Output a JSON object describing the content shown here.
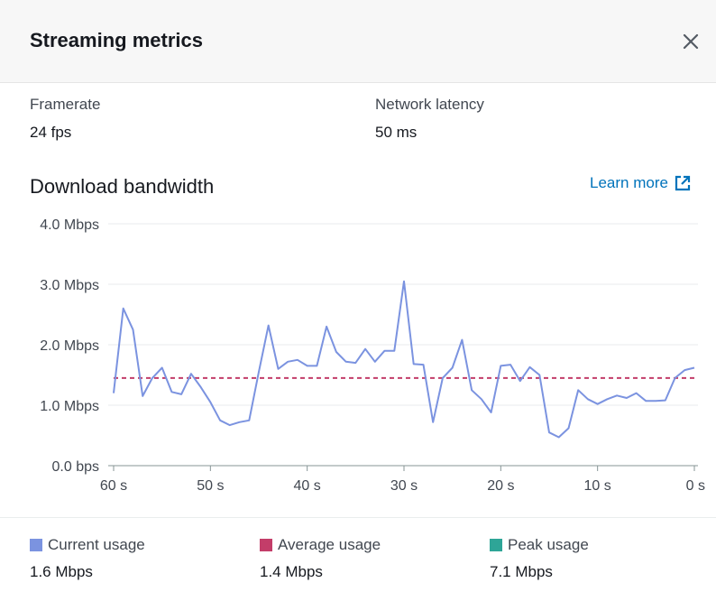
{
  "header": {
    "title": "Streaming metrics"
  },
  "metrics": [
    {
      "label": "Framerate",
      "value": "24 fps"
    },
    {
      "label": "Network latency",
      "value": "50 ms"
    }
  ],
  "bandwidth": {
    "title": "Download bandwidth",
    "learn_more": "Learn more"
  },
  "chart_data": {
    "type": "line",
    "title": "Download bandwidth",
    "x_tick_labels": [
      "60 s",
      "50 s",
      "40 s",
      "30 s",
      "20 s",
      "10 s",
      "0 s"
    ],
    "y_tick_labels": [
      "0.0 bps",
      "1.0 Mbps",
      "2.0 Mbps",
      "3.0 Mbps",
      "4.0 Mbps"
    ],
    "xlim": [
      60,
      0
    ],
    "ylim": [
      0,
      4
    ],
    "grid": true,
    "series": [
      {
        "name": "Current usage",
        "color": "#7b93e0",
        "x": [
          60,
          59,
          58,
          57,
          56,
          55,
          54,
          53,
          52,
          51,
          50,
          49,
          48,
          47,
          46,
          45,
          44,
          43,
          42,
          41,
          40,
          39,
          38,
          37,
          36,
          35,
          34,
          33,
          32,
          31,
          30,
          29,
          28,
          27,
          26,
          25,
          24,
          23,
          22,
          21,
          20,
          19,
          18,
          17,
          16,
          15,
          14,
          13,
          12,
          11,
          10,
          9,
          8,
          7,
          6,
          5,
          4,
          3,
          2,
          1,
          0
        ],
        "values": [
          1.2,
          2.6,
          2.25,
          1.15,
          1.45,
          1.62,
          1.22,
          1.18,
          1.52,
          1.3,
          1.05,
          0.75,
          0.67,
          0.72,
          0.75,
          1.55,
          2.32,
          1.6,
          1.72,
          1.75,
          1.65,
          1.65,
          2.3,
          1.88,
          1.72,
          1.7,
          1.93,
          1.72,
          1.9,
          1.9,
          3.05,
          1.68,
          1.67,
          0.72,
          1.45,
          1.62,
          2.08,
          1.25,
          1.1,
          0.88,
          1.65,
          1.67,
          1.4,
          1.63,
          1.5,
          0.55,
          0.47,
          0.62,
          1.25,
          1.1,
          1.02,
          1.1,
          1.16,
          1.12,
          1.2,
          1.07,
          1.07,
          1.08,
          1.45,
          1.58,
          1.62
        ]
      },
      {
        "name": "Average usage",
        "color": "#c33d69",
        "x": [
          60,
          0
        ],
        "values": [
          1.45,
          1.45
        ]
      }
    ]
  },
  "legend": [
    {
      "label": "Current usage",
      "value": "1.6 Mbps",
      "color": "#7b93e0"
    },
    {
      "label": "Average usage",
      "value": "1.4 Mbps",
      "color": "#c33d69"
    },
    {
      "label": "Peak usage",
      "value": "7.1 Mbps",
      "color": "#2ea597"
    }
  ]
}
